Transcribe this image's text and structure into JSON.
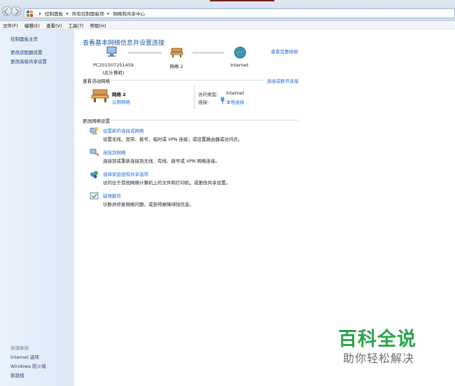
{
  "breadcrumb": {
    "items": [
      "控制面板",
      "所有控制面板项",
      "网络和共享中心"
    ]
  },
  "menu": [
    "文件(F)",
    "编辑(E)",
    "查看(V)",
    "工具(T)",
    "帮助(H)"
  ],
  "sidebar": {
    "links": [
      "控制面板主页",
      "更改适配器设置",
      "更改高级共享设置"
    ],
    "see_also_title": "另请参阅",
    "see_also": [
      "Internet 选项",
      "Windows 防火墙",
      "家庭组"
    ]
  },
  "main": {
    "title": "查看基本网络信息并设置连接",
    "map_link": "查看完整映射",
    "map": {
      "computer_name": "PC201507251459",
      "computer_sub": "(此计算机)",
      "network_name": "网络  2",
      "internet": "Internet"
    },
    "active_networks": {
      "title": "查看活动网络",
      "link": "连接或断开连接",
      "network_name": "网络  2",
      "network_type": "公用网络",
      "access_type_label": "访问类型:",
      "access_type_value": "Internet",
      "connection_label": "连接:",
      "connection_value": "本地连接"
    },
    "change_settings": {
      "title": "更改网络设置",
      "tasks": [
        {
          "title": "设置新的连接或网络",
          "desc": "设置无线、宽带、拨号、临时或 VPN 连接；或设置路由器或访问点。"
        },
        {
          "title": "连接到网络",
          "desc": "连接到或重新连接到无线、有线、拨号或 VPN 网络连接。"
        },
        {
          "title": "选择家庭组和共享选项",
          "desc": "访问位于其他网络计算机上的文件和打印机，或更改共享设置。"
        },
        {
          "title": "疑难解答",
          "desc": "诊断并修复网络问题，或获得故障排除信息。"
        }
      ]
    }
  },
  "watermark": {
    "title": "百科全说",
    "subtitle": "助你轻松解决"
  },
  "colors": {
    "link": "#1d6fd1",
    "heading": "#1d5a9c",
    "sidebar_bg": "#e4eef9",
    "watermark_green": "#2aa54c"
  }
}
